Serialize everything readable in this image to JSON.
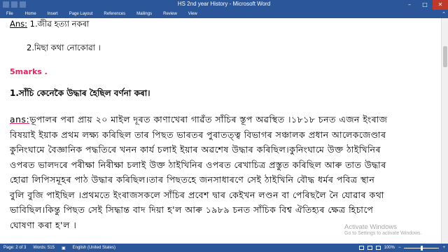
{
  "window": {
    "title": "HS 2nd year History - Microsoft Word"
  },
  "ribbon": {
    "tabs": [
      {
        "label": "File"
      },
      {
        "label": "Home"
      },
      {
        "label": "Insert"
      },
      {
        "label": "Page Layout"
      },
      {
        "label": "References"
      },
      {
        "label": "Mailings"
      },
      {
        "label": "Review"
      },
      {
        "label": "View"
      }
    ]
  },
  "document": {
    "ans_label_1": "Ans:",
    "ans_line_1": " 1.জীৱ  হত্যা  নকৰা",
    "ans_line_2": "2.মিছা  কথা  নোকোৱা  ।",
    "marks_heading": "5marks .",
    "question": "1.সাঁচি কেনেকৈ উদ্ধাৰ হৈছিল বৰ্ণনা কৰা।",
    "answer_label": "ans:",
    "answer_lines": [
      "ভূপালৰ পৰা প্ৰায় ২০ মাইল দূৰত কাণাখেৰা গাৱঁত সাঁচিৰ স্তূপ অৱস্থিত ।১৮১৮ চনত এজন ইংৰাজ",
      "বিষয়াই ইয়াক প্ৰথম লক্ষ্য কৰিছিল তাৰ পিছত ভাৰতৰ পুৰাতত্ত্ব বিভাগৰ সঞ্চালক প্ৰধান আলেকজেণ্ডাৰ",
      "কুনিংঘামে বৈজ্ঞানিক পদ্ধতিৰে খনন কাৰ্য চলাই ইয়াৰ অৱশেষ উদ্ধাৰ কৰিছিল।কুনিংঘামে উক্ত ঠাইখিনিৰ",
      "ওপৰত ভালদৰে পৰীক্ষা নিৰীক্ষা চলাই উক্ত ঠাইখিনিৰ ওপৰত ৰেখাচিত্ৰ প্ৰস্তুত কৰিছিল আৰু তাত উদ্ধাৰ",
      "হোৱা লিপিসমূহৰ পাঠ উদ্ধাৰ কৰিছিল।তাৰ পিছতহে জনসাধাৰণে সেই ঠাইখিনি বৌদ্ধ ধৰ্মৰ পবিত্ৰ স্থান",
      "বুলি বুজি পাইছিল ।প্ৰথমতে ইংৰাজসকলে সাঁচিৰ প্ৰবেশ দ্বাৰ কেইখন লণ্ডন বা পেৰিছলৈ নৈ যোৱাৰ কথা",
      "ভাবিছিল।কিন্তু পিছত  সেই সিদ্ধান্ত বাদ দিয়া হ'ল আৰু ১৯৮৯ চনত সাঁচিক বিশ্ব ঐতিহ্যৰ ক্ষেত্ৰ হিচাপে",
      "ঘোষণা কৰা হ'ল ।"
    ]
  },
  "watermark": {
    "line1": "Activate Windows",
    "line2": "Go to Settings to activate Windows."
  },
  "statusbar": {
    "page": "Page: 2 of 3",
    "words": "Words: 515",
    "language": "English (United States)",
    "zoom": "100%"
  },
  "colors": {
    "word_blue": "#2b579a",
    "marks_pink": "#e0245e"
  }
}
